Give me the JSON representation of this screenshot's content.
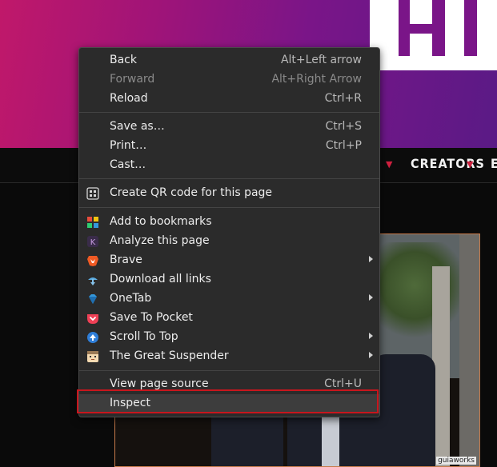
{
  "page": {
    "nav_item": "CREATORS",
    "nav_item_partial": "E",
    "watermark": "guiaworks"
  },
  "menu": {
    "back": {
      "label": "Back",
      "shortcut": "Alt+Left arrow"
    },
    "forward": {
      "label": "Forward",
      "shortcut": "Alt+Right Arrow"
    },
    "reload": {
      "label": "Reload",
      "shortcut": "Ctrl+R"
    },
    "save_as": {
      "label": "Save as…",
      "shortcut": "Ctrl+S"
    },
    "print": {
      "label": "Print…",
      "shortcut": "Ctrl+P"
    },
    "cast": {
      "label": "Cast…"
    },
    "qr": {
      "label": "Create QR code for this page",
      "icon": "qr-code-icon"
    },
    "bookmarks": {
      "label": "Add to bookmarks",
      "icon": "bookmarks-grid-icon"
    },
    "analyze": {
      "label": "Analyze this page",
      "icon": "k-analyze-icon"
    },
    "brave": {
      "label": "Brave",
      "icon": "brave-lion-icon"
    },
    "download_links": {
      "label": "Download all links",
      "icon": "download-all-icon"
    },
    "onetab": {
      "label": "OneTab",
      "icon": "onetab-diamond-icon"
    },
    "pocket": {
      "label": "Save To Pocket",
      "icon": "pocket-icon"
    },
    "scroll_top": {
      "label": "Scroll To Top",
      "icon": "scroll-up-icon"
    },
    "suspender": {
      "label": "The Great Suspender",
      "icon": "suspender-face-icon"
    },
    "view_source": {
      "label": "View page source",
      "shortcut": "Ctrl+U"
    },
    "inspect": {
      "label": "Inspect"
    }
  },
  "colors": {
    "menu_bg": "#2b2b2b",
    "highlight_border": "#c8161d",
    "hero_accent": "#a01478"
  }
}
